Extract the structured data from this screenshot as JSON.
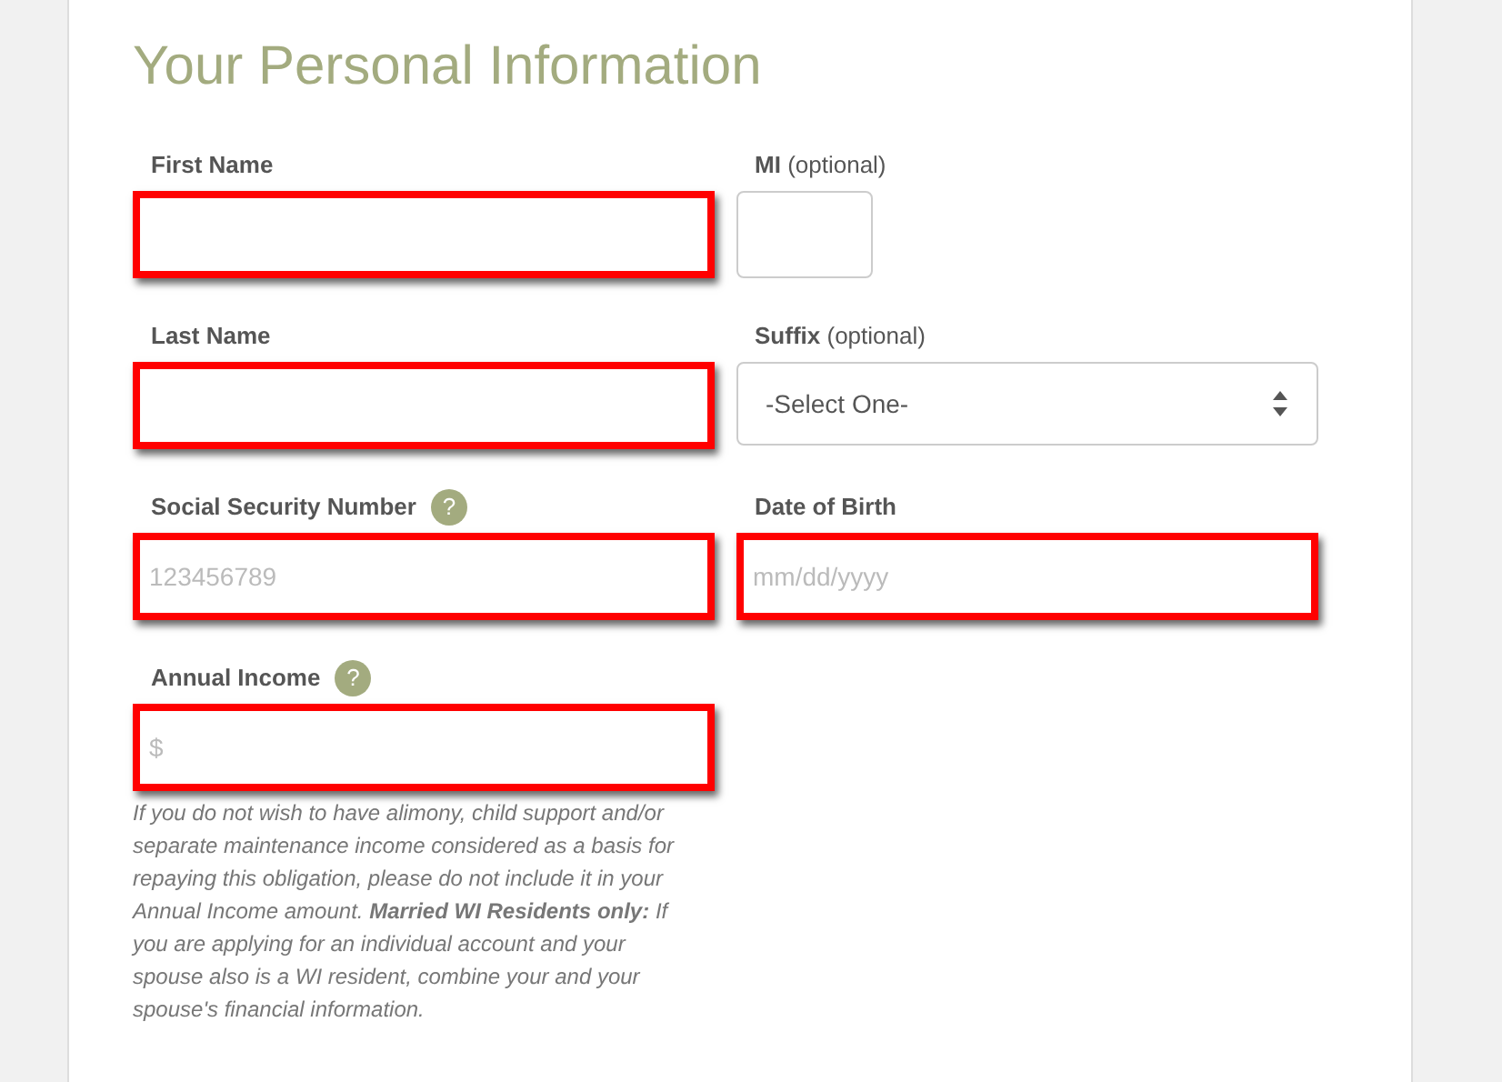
{
  "heading": "Your Personal Information",
  "rows": [
    {
      "fields": [
        {
          "kind": "text",
          "label": "**First Name**",
          "highlighted": true
        },
        {
          "kind": "short_text",
          "label": "**MI** (optional)",
          "highlighted": false
        }
      ]
    },
    {
      "fields": [
        {
          "kind": "text",
          "label": "**Last Name**",
          "highlighted": true
        },
        {
          "kind": "select",
          "label": "**Suffix** (optional)",
          "highlighted": false,
          "value": "-Select One-"
        }
      ]
    },
    {
      "fields": [
        {
          "kind": "text",
          "label": "**Social Security Number**",
          "help_icon": "?",
          "highlighted": true,
          "placeholder": "123456789"
        },
        {
          "kind": "text",
          "label": "**Date of Birth**",
          "highlighted": true,
          "placeholder": "mm/dd/yyyy"
        }
      ]
    },
    {
      "fields": [
        {
          "kind": "text",
          "label": "**Annual Income**",
          "help_icon": "?",
          "highlighted": true,
          "placeholder": "$",
          "note": "If you do not wish to have alimony, child support and/or separate maintenance income considered as a basis for repaying this obligation, please do not include it in your Annual Income amount. **Married WI Residents only:** If you are applying for an individual account and your spouse also is a WI resident, combine your and your spouse's financial information."
        }
      ]
    }
  ]
}
